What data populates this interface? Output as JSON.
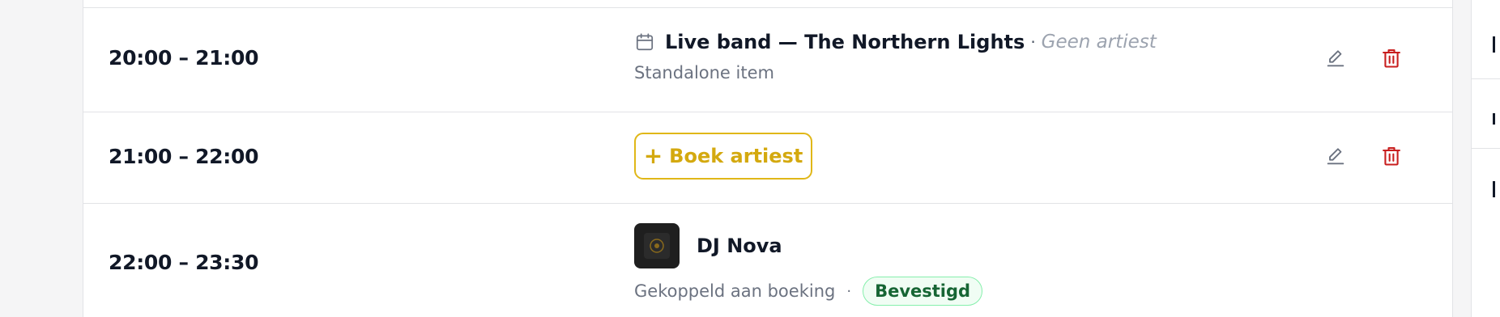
{
  "schedule": {
    "rows": [
      {
        "time": "20:00 – 21:00",
        "icon": "calendar-icon",
        "title": "Live band — The Northern Lights",
        "separator": "·",
        "artist_status": "Geen artiest",
        "subtitle": "Standalone item",
        "actions": {
          "edit": "pencil-icon",
          "delete": "trash-icon"
        }
      },
      {
        "time": "21:00 – 22:00",
        "book_button": {
          "icon": "+",
          "label": "Boek artiest"
        },
        "actions": {
          "edit": "pencil-icon",
          "delete": "trash-icon"
        }
      },
      {
        "time": "22:00 – 23:30",
        "artist": "DJ Nova",
        "booking_text": "Gekoppeld aan boeking",
        "separator": "·",
        "status_badge": "Bevestigd"
      }
    ]
  },
  "colors": {
    "accent_yellow": "#e0b718",
    "delete_red": "#c81e1e",
    "badge_green": "#166534",
    "badge_green_bg": "#f0fdf4"
  }
}
